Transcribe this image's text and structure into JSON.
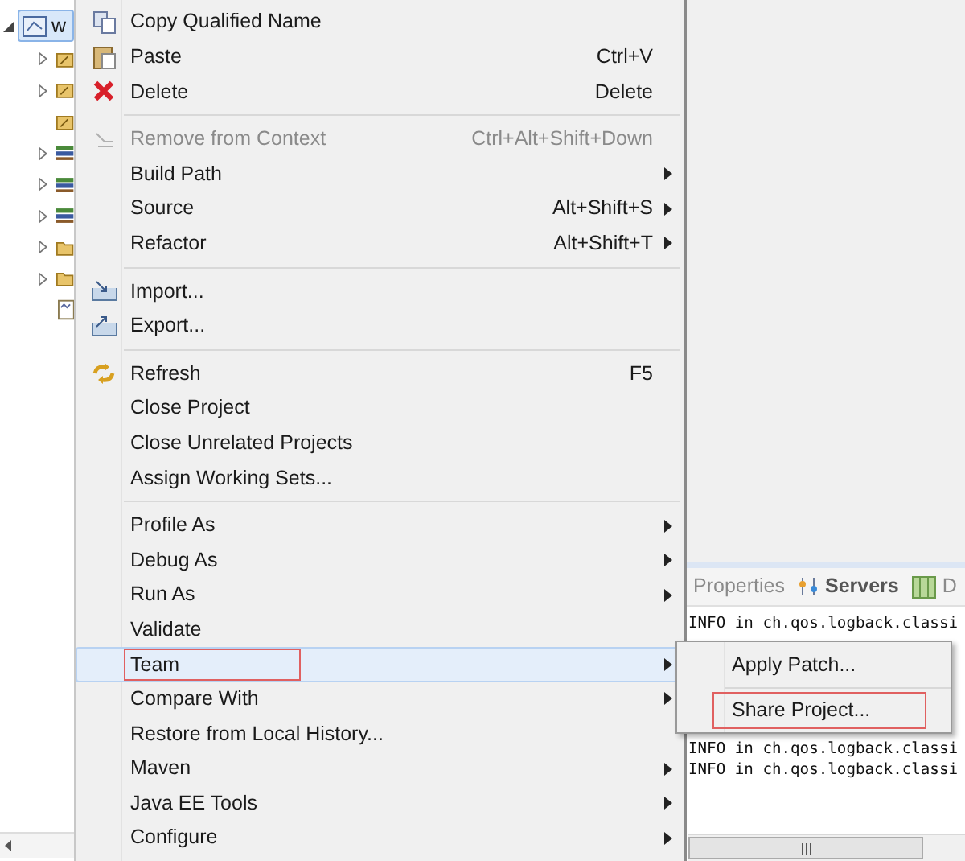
{
  "project_tree": {
    "label": "w",
    "selected": true,
    "expanded": true,
    "children": [
      {
        "kind": "package",
        "expandable": true
      },
      {
        "kind": "package",
        "expandable": true
      },
      {
        "kind": "package",
        "expandable": false
      },
      {
        "kind": "library",
        "expandable": true
      },
      {
        "kind": "library",
        "expandable": true
      },
      {
        "kind": "library",
        "expandable": true
      },
      {
        "kind": "folder",
        "expandable": true
      },
      {
        "kind": "folder",
        "expandable": true
      },
      {
        "kind": "file",
        "expandable": false
      }
    ]
  },
  "context_menu": {
    "items": [
      {
        "kind": "item",
        "label": "Copy Qualified Name",
        "disabled": false,
        "submenu": false,
        "highlighted": false,
        "annotated": false
      },
      {
        "kind": "item",
        "label": "Paste",
        "shortcut": "Ctrl+V",
        "disabled": false,
        "submenu": false,
        "highlighted": false,
        "annotated": false
      },
      {
        "kind": "item",
        "label": "Delete",
        "shortcut": "Delete",
        "disabled": false,
        "submenu": false,
        "highlighted": false,
        "annotated": false
      },
      {
        "kind": "separator"
      },
      {
        "kind": "item",
        "label": "Remove from Context",
        "shortcut": "Ctrl+Alt+Shift+Down",
        "disabled": true,
        "submenu": false,
        "highlighted": false,
        "annotated": false
      },
      {
        "kind": "item",
        "label": "Build Path",
        "disabled": false,
        "submenu": true,
        "highlighted": false,
        "annotated": false
      },
      {
        "kind": "item",
        "label": "Source",
        "shortcut": "Alt+Shift+S",
        "disabled": false,
        "submenu": true,
        "highlighted": false,
        "annotated": false
      },
      {
        "kind": "item",
        "label": "Refactor",
        "shortcut": "Alt+Shift+T",
        "disabled": false,
        "submenu": true,
        "highlighted": false,
        "annotated": false
      },
      {
        "kind": "separator"
      },
      {
        "kind": "item",
        "label": "Import...",
        "disabled": false,
        "submenu": false,
        "highlighted": false,
        "annotated": false
      },
      {
        "kind": "item",
        "label": "Export...",
        "disabled": false,
        "submenu": false,
        "highlighted": false,
        "annotated": false
      },
      {
        "kind": "separator"
      },
      {
        "kind": "item",
        "label": "Refresh",
        "shortcut": "F5",
        "disabled": false,
        "submenu": false,
        "highlighted": false,
        "annotated": false
      },
      {
        "kind": "item",
        "label": "Close Project",
        "disabled": false,
        "submenu": false,
        "highlighted": false,
        "annotated": false
      },
      {
        "kind": "item",
        "label": "Close Unrelated Projects",
        "disabled": false,
        "submenu": false,
        "highlighted": false,
        "annotated": false
      },
      {
        "kind": "item",
        "label": "Assign Working Sets...",
        "disabled": false,
        "submenu": false,
        "highlighted": false,
        "annotated": false
      },
      {
        "kind": "separator"
      },
      {
        "kind": "item",
        "label": "Profile As",
        "disabled": false,
        "submenu": true,
        "highlighted": false,
        "annotated": false
      },
      {
        "kind": "item",
        "label": "Debug As",
        "disabled": false,
        "submenu": true,
        "highlighted": false,
        "annotated": false
      },
      {
        "kind": "item",
        "label": "Run As",
        "disabled": false,
        "submenu": true,
        "highlighted": false,
        "annotated": false
      },
      {
        "kind": "item",
        "label": "Validate",
        "disabled": false,
        "submenu": false,
        "highlighted": false,
        "annotated": false
      },
      {
        "kind": "item",
        "label": "Team",
        "disabled": false,
        "submenu": true,
        "highlighted": true,
        "annotated": true
      },
      {
        "kind": "item",
        "label": "Compare With",
        "disabled": false,
        "submenu": true,
        "highlighted": false,
        "annotated": false
      },
      {
        "kind": "item",
        "label": "Restore from Local History...",
        "disabled": false,
        "submenu": false,
        "highlighted": false,
        "annotated": false
      },
      {
        "kind": "item",
        "label": "Maven",
        "disabled": false,
        "submenu": true,
        "highlighted": false,
        "annotated": false
      },
      {
        "kind": "item",
        "label": "Java EE Tools",
        "disabled": false,
        "submenu": true,
        "highlighted": false,
        "annotated": false
      },
      {
        "kind": "item",
        "label": "Configure",
        "disabled": false,
        "submenu": true,
        "highlighted": false,
        "annotated": false
      }
    ]
  },
  "team_submenu": {
    "items": [
      {
        "kind": "item",
        "label": "Apply Patch...",
        "annotated": false
      },
      {
        "kind": "separator"
      },
      {
        "kind": "item",
        "label": "Share Project...",
        "annotated": true
      }
    ]
  },
  "bottom_panel": {
    "tabs": [
      {
        "label": "Properties",
        "selected": false
      },
      {
        "label": "Servers",
        "selected": true
      },
      {
        "label": "D",
        "selected": false
      }
    ],
    "console_lines_top": [
      "INFO in ch.qos.logback.classi"
    ],
    "console_lines_bottom": [
      "INFO in ch.qos.logback.classi",
      "INFO in ch.qos.logback.classi"
    ]
  }
}
